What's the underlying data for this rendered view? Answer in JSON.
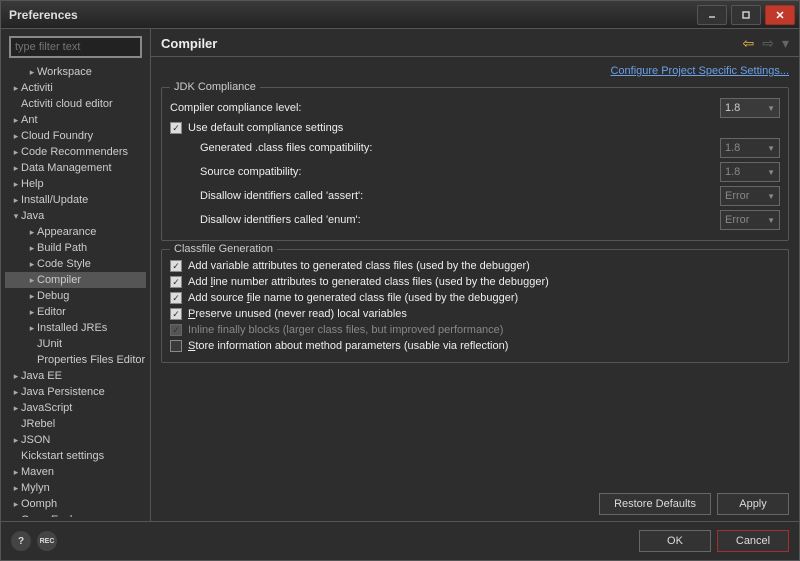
{
  "window": {
    "title": "Preferences"
  },
  "sidebar": {
    "filter_placeholder": "type filter text",
    "items": [
      {
        "label": "Workspace",
        "level": 2,
        "caret": "closed"
      },
      {
        "label": "Activiti",
        "level": 1,
        "caret": "closed"
      },
      {
        "label": "Activiti cloud editor",
        "level": 1,
        "caret": "none"
      },
      {
        "label": "Ant",
        "level": 1,
        "caret": "closed"
      },
      {
        "label": "Cloud Foundry",
        "level": 1,
        "caret": "closed"
      },
      {
        "label": "Code Recommenders",
        "level": 1,
        "caret": "closed"
      },
      {
        "label": "Data Management",
        "level": 1,
        "caret": "closed"
      },
      {
        "label": "Help",
        "level": 1,
        "caret": "closed"
      },
      {
        "label": "Install/Update",
        "level": 1,
        "caret": "closed"
      },
      {
        "label": "Java",
        "level": 1,
        "caret": "open"
      },
      {
        "label": "Appearance",
        "level": 2,
        "caret": "closed"
      },
      {
        "label": "Build Path",
        "level": 2,
        "caret": "closed"
      },
      {
        "label": "Code Style",
        "level": 2,
        "caret": "closed"
      },
      {
        "label": "Compiler",
        "level": 2,
        "caret": "closed",
        "selected": true
      },
      {
        "label": "Debug",
        "level": 2,
        "caret": "closed"
      },
      {
        "label": "Editor",
        "level": 2,
        "caret": "closed"
      },
      {
        "label": "Installed JREs",
        "level": 2,
        "caret": "closed"
      },
      {
        "label": "JUnit",
        "level": 2,
        "caret": "none"
      },
      {
        "label": "Properties Files Editor",
        "level": 2,
        "caret": "none"
      },
      {
        "label": "Java EE",
        "level": 1,
        "caret": "closed"
      },
      {
        "label": "Java Persistence",
        "level": 1,
        "caret": "closed"
      },
      {
        "label": "JavaScript",
        "level": 1,
        "caret": "closed"
      },
      {
        "label": "JRebel",
        "level": 1,
        "caret": "none"
      },
      {
        "label": "JSON",
        "level": 1,
        "caret": "closed"
      },
      {
        "label": "Kickstart settings",
        "level": 1,
        "caret": "none"
      },
      {
        "label": "Maven",
        "level": 1,
        "caret": "closed"
      },
      {
        "label": "Mylyn",
        "level": 1,
        "caret": "closed"
      },
      {
        "label": "Oomph",
        "level": 1,
        "caret": "closed"
      },
      {
        "label": "Open Explorer",
        "level": 1,
        "caret": "closed"
      }
    ]
  },
  "header": {
    "title": "Compiler",
    "link": "Configure Project Specific Settings..."
  },
  "jdk": {
    "title": "JDK Compliance",
    "compliance_label": "Compiler compliance level:",
    "compliance_value": "1.8",
    "use_default": "Use default compliance settings",
    "gen_class": "Generated .class files compatibility:",
    "gen_class_value": "1.8",
    "source_compat": "Source compatibility:",
    "source_compat_value": "1.8",
    "disallow_assert": "Disallow identifiers called 'assert':",
    "disallow_assert_value": "Error",
    "disallow_enum": "Disallow identifiers called 'enum':",
    "disallow_enum_value": "Error"
  },
  "classfile": {
    "title": "Classfile Generation",
    "c1": "Add variable attributes to generated class files (used by the debugger)",
    "c2_a": "Add ",
    "c2_u": "l",
    "c2_b": "ine number attributes to generated class files (used by the debugger)",
    "c3_a": "Add source ",
    "c3_u": "f",
    "c3_b": "ile name to generated class file (used by the debugger)",
    "c4_u": "P",
    "c4_b": "reserve unused (never read) local variables",
    "c5": "Inline finally blocks (larger class files, but improved performance)",
    "c6_u": "S",
    "c6_b": "tore information about method parameters (usable via reflection)"
  },
  "buttons": {
    "restore": "Restore Defaults",
    "apply": "Apply",
    "ok": "OK",
    "cancel": "Cancel"
  }
}
